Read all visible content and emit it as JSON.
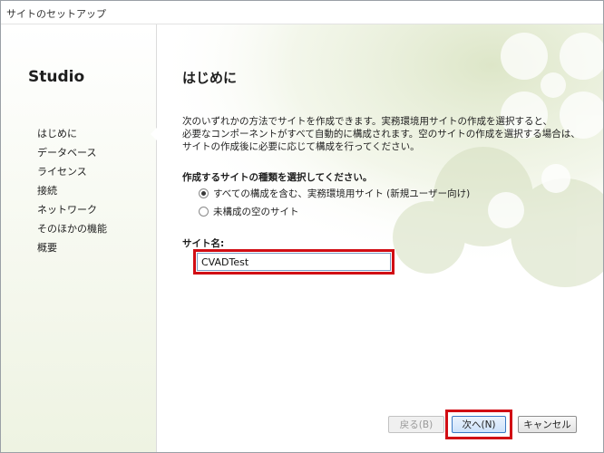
{
  "window": {
    "title": "サイトのセットアップ"
  },
  "sidebar": {
    "brand": "Studio",
    "items": [
      {
        "label": "はじめに",
        "active": true
      },
      {
        "label": "データベース",
        "active": false
      },
      {
        "label": "ライセンス",
        "active": false
      },
      {
        "label": "接続",
        "active": false
      },
      {
        "label": "ネットワーク",
        "active": false
      },
      {
        "label": "そのほかの機能",
        "active": false
      },
      {
        "label": "概要",
        "active": false
      }
    ]
  },
  "main": {
    "title": "はじめに",
    "intro_lines": [
      "次のいずれかの方法でサイトを作成できます。実務環境用サイトの作成を選択すると、",
      "必要なコンポーネントがすべて自動的に構成されます。空のサイトの作成を選択する場合は、",
      "サイトの作成後に必要に応じて構成を行ってください。"
    ],
    "site_type_label": "作成するサイトの種類を選択してください。",
    "options": [
      {
        "label": "すべての構成を含む、実務環境用サイト (新規ユーザー向け)",
        "selected": true
      },
      {
        "label": "未構成の空のサイト",
        "selected": false
      }
    ],
    "site_name_label": "サイト名:",
    "site_name_value": "CVADTest"
  },
  "footer": {
    "back_label": "戻る(B)",
    "next_label": "次へ(N)",
    "cancel_label": "キャンセル"
  },
  "colors": {
    "highlight": "#d10d14",
    "decoration": "#dfe8cc"
  }
}
